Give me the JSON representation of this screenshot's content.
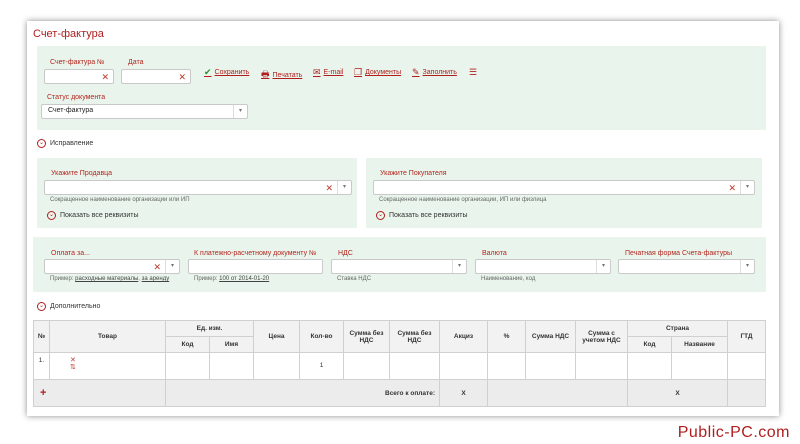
{
  "title": "Счет-фактура",
  "header": {
    "invoice_number_label": "Счет-фактура №",
    "date_label": "Дата",
    "status_label": "Статус документа",
    "status_value": "Счет-фактура"
  },
  "toolbar": {
    "save": "Сохранить",
    "print": "Печатать",
    "email": "E-mail",
    "documents": "Документы",
    "fill": "Заполнить"
  },
  "correction_toggle": "Исправление",
  "seller": {
    "label": "Укажите Продавца",
    "hint": "Сокращенное наименование организации или ИП",
    "show_all": "Показать все реквизиты"
  },
  "buyer": {
    "label": "Укажите Покупателя",
    "hint": "Сокращенное наименование организации, ИП или физлица",
    "show_all": "Показать все реквизиты"
  },
  "payment": {
    "payment_for_label": "Оплата за...",
    "payment_for_hint_prefix": "Пример:",
    "payment_for_hint_link1": "расходные материалы",
    "payment_for_hint_link2": "за аренду",
    "payment_doc_label": "К платежно-расчетному документу №",
    "payment_doc_hint_prefix": "Пример:",
    "payment_doc_hint_link": "100 от 2014-01-20",
    "vat_label": "НДС",
    "vat_hint": "Ставка НДС",
    "currency_label": "Валюта",
    "currency_hint": "Наименование, код",
    "print_form_label": "Печатная форма Счета-фактуры"
  },
  "additional_toggle": "Дополнительно",
  "table": {
    "headers": {
      "num": "№",
      "product": "Товар",
      "unit": "Ед. изм.",
      "unit_code": "Код",
      "unit_name": "Имя",
      "price": "Цена",
      "qty": "Кол-во",
      "sum_no_vat": "Сумма без НДС",
      "sum_no_vat2": "Сумма без НДС",
      "excise": "Акциз",
      "percent": "%",
      "vat_sum": "Сумма НДС",
      "sum_with_vat": "Сумма с учетом НДС",
      "country": "Страна",
      "country_code": "Код",
      "country_name": "Название",
      "gtd": "ГТД"
    },
    "rows": [
      {
        "num": "1.",
        "qty": "1"
      }
    ],
    "total_label": "Всего к оплате:",
    "total_excise": "X",
    "total_country": "X"
  },
  "watermark": "Public-PC.com"
}
